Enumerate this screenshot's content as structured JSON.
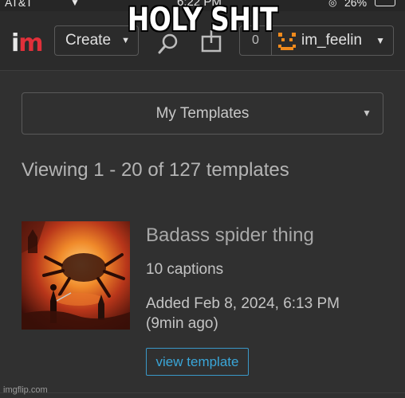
{
  "status_bar": {
    "carrier": "AT&T",
    "time": "6:22 PM",
    "battery": "26%"
  },
  "meme_caption": "HOLY SHIT",
  "header": {
    "logo_i": "i",
    "logo_m": "m",
    "create_label": "Create",
    "notification_count": "0",
    "username": "im_feelin"
  },
  "templates_select": {
    "selected": "My Templates"
  },
  "viewing_text": "Viewing 1 - 20 of 127 templates",
  "template": {
    "title": "Badass spider thing",
    "captions": "10 captions",
    "added": "Added Feb 8, 2024, 6:13 PM",
    "ago": "(9min ago)",
    "view_label": "view template"
  },
  "watermark": "imgflip.com",
  "colors": {
    "background": "#303030",
    "logo_accent": "#e0303a",
    "link_blue": "#3aa6d8",
    "avatar_orange": "#f08a1c"
  }
}
